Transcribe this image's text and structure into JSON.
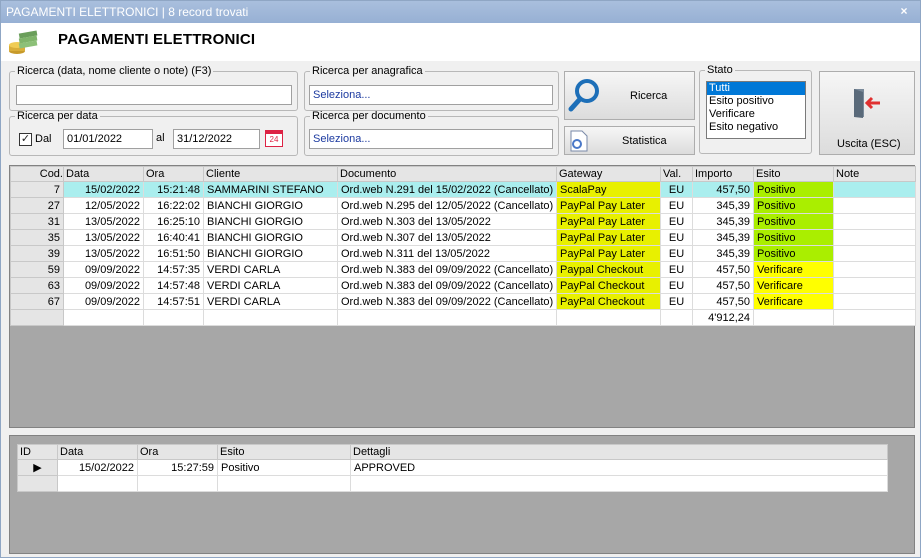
{
  "window": {
    "title": "PAGAMENTI ELETTRONICI | 8 record trovati",
    "close": "×"
  },
  "header": {
    "title": "PAGAMENTI ELETTRONICI"
  },
  "filters": {
    "search_label": "Ricerca (data, nome cliente o note) (F3)",
    "search_value": "",
    "anag_label": "Ricerca per anagrafica",
    "anag_value": "Seleziona...",
    "date_label": "Ricerca per data",
    "dal_label": "Dal",
    "date_from": "01/01/2022",
    "al_label": "al",
    "date_to": "31/12/2022",
    "doc_label": "Ricerca per documento",
    "doc_value": "Seleziona...",
    "calendar_badge": "24"
  },
  "buttons": {
    "search": "Ricerca",
    "stats": "Statistica",
    "exit": "Uscita (ESC)"
  },
  "stato": {
    "label": "Stato",
    "options": [
      "Tutti",
      "Esito positivo",
      "Verificare",
      "Esito negativo"
    ]
  },
  "colors": {
    "positivo": "#aaee00",
    "verificare": "#ffff00",
    "selected_row": "#aaeeee",
    "gateway": "#e8f000"
  },
  "main_grid": {
    "headers": [
      "Cod.",
      "Data",
      "Ora",
      "Cliente",
      "Documento",
      "Gateway",
      "Val.",
      "Importo",
      "Esito",
      "Note"
    ],
    "rows": [
      {
        "cod": "7",
        "data": "15/02/2022",
        "ora": "15:21:48",
        "cliente": "SAMMARINI STEFANO",
        "doc": "Ord.web N.291 del 15/02/2022 (Cancellato)",
        "gateway": "ScalaPay",
        "val": "EU",
        "importo": "457,50",
        "esito": "Positivo",
        "note": ""
      },
      {
        "cod": "27",
        "data": "12/05/2022",
        "ora": "16:22:02",
        "cliente": "BIANCHI GIORGIO",
        "doc": "Ord.web N.295 del 12/05/2022 (Cancellato)",
        "gateway": "PayPal Pay Later",
        "val": "EU",
        "importo": "345,39",
        "esito": "Positivo",
        "note": ""
      },
      {
        "cod": "31",
        "data": "13/05/2022",
        "ora": "16:25:10",
        "cliente": "BIANCHI GIORGIO",
        "doc": "Ord.web N.303 del 13/05/2022",
        "gateway": "PayPal Pay Later",
        "val": "EU",
        "importo": "345,39",
        "esito": "Positivo",
        "note": ""
      },
      {
        "cod": "35",
        "data": "13/05/2022",
        "ora": "16:40:41",
        "cliente": "BIANCHI GIORGIO",
        "doc": "Ord.web N.307 del 13/05/2022",
        "gateway": "PayPal Pay Later",
        "val": "EU",
        "importo": "345,39",
        "esito": "Positivo",
        "note": ""
      },
      {
        "cod": "39",
        "data": "13/05/2022",
        "ora": "16:51:50",
        "cliente": "BIANCHI GIORGIO",
        "doc": "Ord.web N.311 del 13/05/2022",
        "gateway": "PayPal Pay Later",
        "val": "EU",
        "importo": "345,39",
        "esito": "Positivo",
        "note": ""
      },
      {
        "cod": "59",
        "data": "09/09/2022",
        "ora": "14:57:35",
        "cliente": "VERDI CARLA",
        "doc": "Ord.web N.383 del 09/09/2022 (Cancellato)",
        "gateway": "Paypal Checkout",
        "val": "EU",
        "importo": "457,50",
        "esito": "Verificare",
        "note": ""
      },
      {
        "cod": "63",
        "data": "09/09/2022",
        "ora": "14:57:48",
        "cliente": "VERDI CARLA",
        "doc": "Ord.web N.383 del 09/09/2022 (Cancellato)",
        "gateway": "PayPal Checkout",
        "val": "EU",
        "importo": "457,50",
        "esito": "Verificare",
        "note": ""
      },
      {
        "cod": "67",
        "data": "09/09/2022",
        "ora": "14:57:51",
        "cliente": "VERDI CARLA",
        "doc": "Ord.web N.383 del 09/09/2022 (Cancellato)",
        "gateway": "PayPal Checkout",
        "val": "EU",
        "importo": "457,50",
        "esito": "Verificare",
        "note": ""
      }
    ],
    "total": "4'912,24"
  },
  "detail_grid": {
    "headers": [
      "ID",
      "Data",
      "Ora",
      "Esito",
      "Dettagli"
    ],
    "rows": [
      {
        "id": "",
        "data": "15/02/2022",
        "ora": "15:27:59",
        "esito": "Positivo",
        "dettagli": "APPROVED"
      }
    ]
  }
}
